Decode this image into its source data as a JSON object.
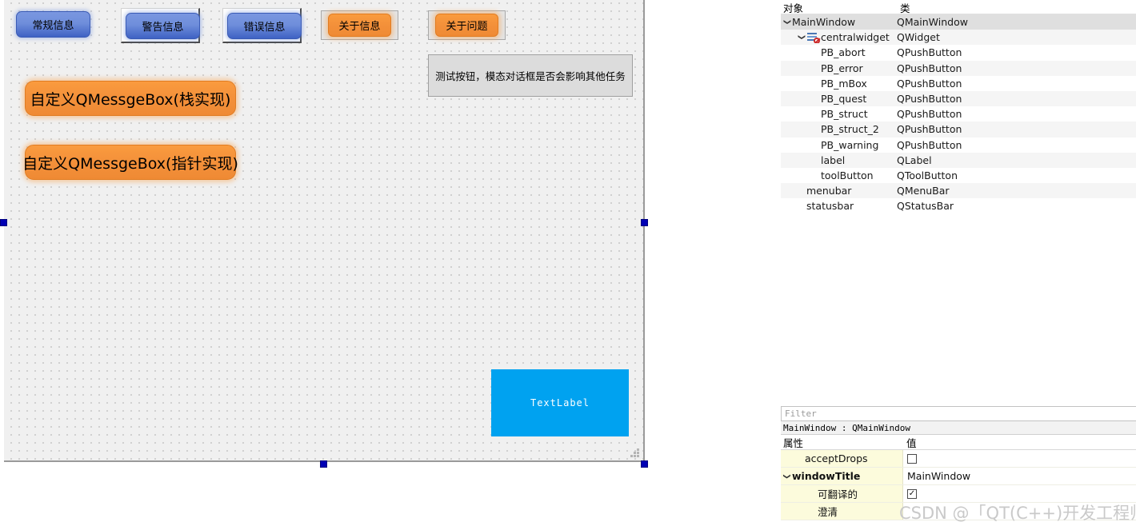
{
  "form": {
    "buttons_blue": [
      {
        "text": "常规信息",
        "name": "normal-info-button"
      },
      {
        "text": "警告信息",
        "name": "warning-info-button"
      },
      {
        "text": "错误信息",
        "name": "error-info-button"
      }
    ],
    "buttons_orange_small": [
      {
        "text": "关于信息",
        "name": "about-info-button"
      },
      {
        "text": "关于问题",
        "name": "about-question-button"
      }
    ],
    "buttons_orange_big": [
      {
        "text": "自定义QMessgeBox(栈实现)",
        "name": "custom-msgbox-stack-button"
      },
      {
        "text": "自定义QMessgeBox(指针实现)",
        "name": "custom-msgbox-pointer-button"
      }
    ],
    "gray_label": "测试按钮，模态对话框是否会影响其他任务",
    "cyan_label": "TextLabel",
    "colors": {
      "blue_button": "#5d7fd6",
      "orange_button": "#f3903a",
      "cyan_label": "#00a2f0",
      "canvas": "#f0f0f0",
      "selection_handle": "#0000b4"
    }
  },
  "object_inspector": {
    "columns": [
      "对象",
      "类"
    ],
    "rows": [
      {
        "name": "MainWindow",
        "class": "QMainWindow",
        "depth": 0,
        "twisty": "v",
        "icon": "none",
        "selected": true
      },
      {
        "name": "centralwidget",
        "class": "QWidget",
        "depth": 1,
        "twisty": "v",
        "icon": "widget-blocked",
        "selected": false
      },
      {
        "name": "PB_abort",
        "class": "QPushButton",
        "depth": 2,
        "twisty": "",
        "icon": "none",
        "selected": false
      },
      {
        "name": "PB_error",
        "class": "QPushButton",
        "depth": 2,
        "twisty": "",
        "icon": "none",
        "selected": false
      },
      {
        "name": "PB_mBox",
        "class": "QPushButton",
        "depth": 2,
        "twisty": "",
        "icon": "none",
        "selected": false
      },
      {
        "name": "PB_quest",
        "class": "QPushButton",
        "depth": 2,
        "twisty": "",
        "icon": "none",
        "selected": false
      },
      {
        "name": "PB_struct",
        "class": "QPushButton",
        "depth": 2,
        "twisty": "",
        "icon": "none",
        "selected": false
      },
      {
        "name": "PB_struct_2",
        "class": "QPushButton",
        "depth": 2,
        "twisty": "",
        "icon": "none",
        "selected": false
      },
      {
        "name": "PB_warning",
        "class": "QPushButton",
        "depth": 2,
        "twisty": "",
        "icon": "none",
        "selected": false
      },
      {
        "name": "label",
        "class": "QLabel",
        "depth": 2,
        "twisty": "",
        "icon": "none",
        "selected": false
      },
      {
        "name": "toolButton",
        "class": "QToolButton",
        "depth": 2,
        "twisty": "",
        "icon": "none",
        "selected": false
      },
      {
        "name": "menubar",
        "class": "QMenuBar",
        "depth": 1,
        "twisty": "",
        "icon": "none",
        "selected": false
      },
      {
        "name": "statusbar",
        "class": "QStatusBar",
        "depth": 1,
        "twisty": "",
        "icon": "none",
        "selected": false
      }
    ]
  },
  "property_editor": {
    "filter_placeholder": "Filter",
    "object_title": "MainWindow : QMainWindow",
    "columns": [
      "属性",
      "值"
    ],
    "rows": [
      {
        "name": "acceptDrops",
        "value": "",
        "type": "checkbox",
        "checked": false,
        "indent": 1,
        "twisty": "",
        "bold": false
      },
      {
        "name": "windowTitle",
        "value": "MainWindow",
        "type": "text",
        "checked": false,
        "indent": 0,
        "twisty": "v",
        "bold": true
      },
      {
        "name": "可翻译的",
        "value": "",
        "type": "checkbox",
        "checked": true,
        "indent": 2,
        "twisty": "",
        "bold": false
      },
      {
        "name": "澄清",
        "value": "",
        "type": "text",
        "checked": false,
        "indent": 2,
        "twisty": "",
        "bold": false
      }
    ]
  },
  "watermark": {
    "text": "CSDN @「QT(C++)开发工程师」"
  }
}
